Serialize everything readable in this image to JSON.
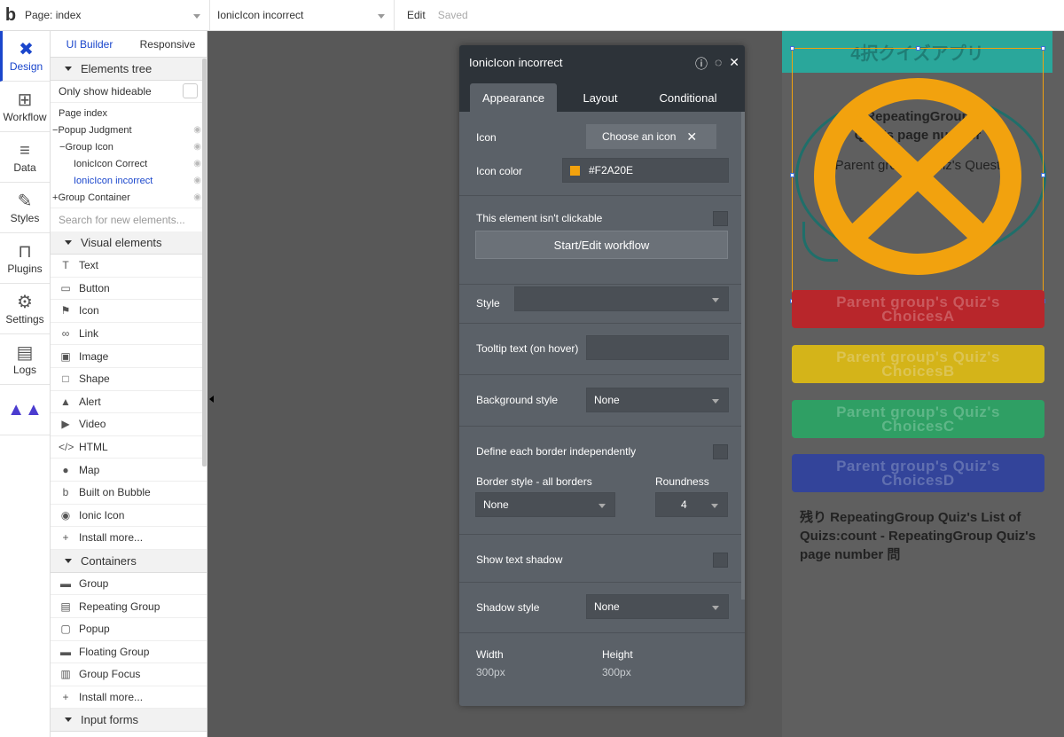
{
  "topbar": {
    "logo": "b",
    "page_label": "Page: index",
    "element_label": "IonicIcon incorrect",
    "edit": "Edit",
    "saved": "Saved"
  },
  "iconcol": {
    "design": "Design",
    "workflow": "Workflow",
    "data": "Data",
    "styles": "Styles",
    "plugins": "Plugins",
    "settings": "Settings",
    "logs": "Logs"
  },
  "palette": {
    "tab_ui": "UI Builder",
    "tab_responsive": "Responsive",
    "elements_tree": "Elements tree",
    "only_show_hideable": "Only show hideable",
    "tree": [
      {
        "label": "Page index",
        "indent": 0,
        "prefix": "",
        "eye": false
      },
      {
        "label": "Popup Judgment",
        "indent": 0,
        "prefix": "−",
        "eye": true
      },
      {
        "label": "Group Icon",
        "indent": 1,
        "prefix": "−",
        "eye": true
      },
      {
        "label": "IonicIcon Correct",
        "indent": 2,
        "prefix": "",
        "eye": true
      },
      {
        "label": "IonicIcon incorrect",
        "indent": 2,
        "prefix": "",
        "eye": true
      },
      {
        "label": "Group Container",
        "indent": 0,
        "prefix": "+",
        "eye": true
      }
    ],
    "search_placeholder": "Search for new elements...",
    "visual_elements": "Visual elements",
    "visual": [
      {
        "icon": "T",
        "label": "Text"
      },
      {
        "icon": "▭",
        "label": "Button"
      },
      {
        "icon": "⚑",
        "label": "Icon"
      },
      {
        "icon": "∞",
        "label": "Link"
      },
      {
        "icon": "▣",
        "label": "Image"
      },
      {
        "icon": "□",
        "label": "Shape"
      },
      {
        "icon": "▲",
        "label": "Alert"
      },
      {
        "icon": "▶",
        "label": "Video"
      },
      {
        "icon": "</>",
        "label": "HTML"
      },
      {
        "icon": "●",
        "label": "Map"
      },
      {
        "icon": "b",
        "label": "Built on Bubble"
      },
      {
        "icon": "◉",
        "label": "Ionic Icon"
      },
      {
        "icon": "+",
        "label": "Install more..."
      }
    ],
    "containers": "Containers",
    "container_items": [
      {
        "icon": "▬",
        "label": "Group"
      },
      {
        "icon": "▤",
        "label": "Repeating Group"
      },
      {
        "icon": "▢",
        "label": "Popup"
      },
      {
        "icon": "▬",
        "label": "Floating Group"
      },
      {
        "icon": "▥",
        "label": "Group Focus"
      },
      {
        "icon": "+",
        "label": "Install more..."
      }
    ],
    "input_forms": "Input forms"
  },
  "canvas": {
    "title": "4択クイズアプリ",
    "bubble_line1": "RepeatingGroup",
    "bubble_line2": "Quiz's page number",
    "bubble_line3": "Parent group's Quiz's Quest",
    "choices": [
      {
        "label": "Parent group's Quiz's ChoicesA",
        "bg": "#b8262b",
        "fg": "#c95a5e"
      },
      {
        "label": "Parent group's Quiz's ChoicesB",
        "bg": "#d4b419",
        "fg": "#dcc454"
      },
      {
        "label": "Parent group's Quiz's ChoicesC",
        "bg": "#2f9f64",
        "fg": "#5fb688"
      },
      {
        "label": "Parent group's Quiz's ChoicesD",
        "bg": "#33449a",
        "fg": "#6170b0"
      }
    ],
    "footer": "残り RepeatingGroup Quiz's List of Quizs:count - RepeatingGroup Quiz's page number 問",
    "icon_color": "#F2A20E"
  },
  "editor": {
    "title": "IonicIcon incorrect",
    "tabs": [
      "Appearance",
      "Layout",
      "Conditional"
    ],
    "icon_label": "Icon",
    "choose_icon": "Choose an icon",
    "icon_color_label": "Icon color",
    "icon_color_value": "#F2A20E",
    "not_clickable": "This element isn't clickable",
    "start_workflow": "Start/Edit workflow",
    "style_label": "Style",
    "style_value": "",
    "tooltip_label": "Tooltip text (on hover)",
    "bg_style_label": "Background style",
    "bg_style_value": "None",
    "border_indep": "Define each border independently",
    "border_style_label": "Border style - all borders",
    "roundness_label": "Roundness",
    "border_style_value": "None",
    "roundness_value": "4",
    "text_shadow": "Show text shadow",
    "shadow_style_label": "Shadow style",
    "shadow_style_value": "None",
    "width_label": "Width",
    "width_value": "300px",
    "height_label": "Height",
    "height_value": "300px"
  }
}
